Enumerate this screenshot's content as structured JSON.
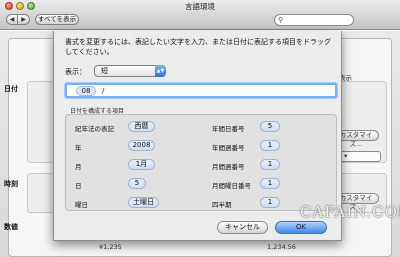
{
  "window": {
    "title": "言語環境",
    "show_all_label": "すべてを表示",
    "nav_back": "◀",
    "nav_forward": "▶",
    "search_icon": "magnifier-icon"
  },
  "background": {
    "sections": {
      "date": "日付",
      "time": "時刻",
      "numbers": "数値"
    },
    "display_label": "表示",
    "customize_label": "カスタマイズ...",
    "number_sample_1": "¥1,235",
    "number_sample_2": "1,234.56"
  },
  "sheet": {
    "instruction": "書式を変更するには、表記したい文字を入力、または日付に表記する項目をドラッグしてください。",
    "display_label": "表示：",
    "display_value": "短",
    "format_field": {
      "token": "08",
      "separator": "/"
    },
    "group_label": "日付を構成する項目",
    "left_items": [
      {
        "label": "紀年法の表記",
        "value": "西暦"
      },
      {
        "label": "年",
        "value": "2008"
      },
      {
        "label": "月",
        "value": "1月"
      },
      {
        "label": "日",
        "value": "5"
      },
      {
        "label": "曜日",
        "value": "土曜日"
      }
    ],
    "right_items": [
      {
        "label": "年間日番号",
        "value": "5"
      },
      {
        "label": "年間週番号",
        "value": "1"
      },
      {
        "label": "月間週番号",
        "value": "1"
      },
      {
        "label": "月間曜日番号",
        "value": "1"
      },
      {
        "label": "四半期",
        "value": "1"
      }
    ],
    "cancel_label": "キャンセル",
    "ok_label": "OK"
  },
  "watermark": "CAFAIN.COM",
  "colors": {
    "accent": "#3f86e6",
    "focus_ring": "#7ab0ef",
    "token_fill": "#dbe6f7"
  }
}
